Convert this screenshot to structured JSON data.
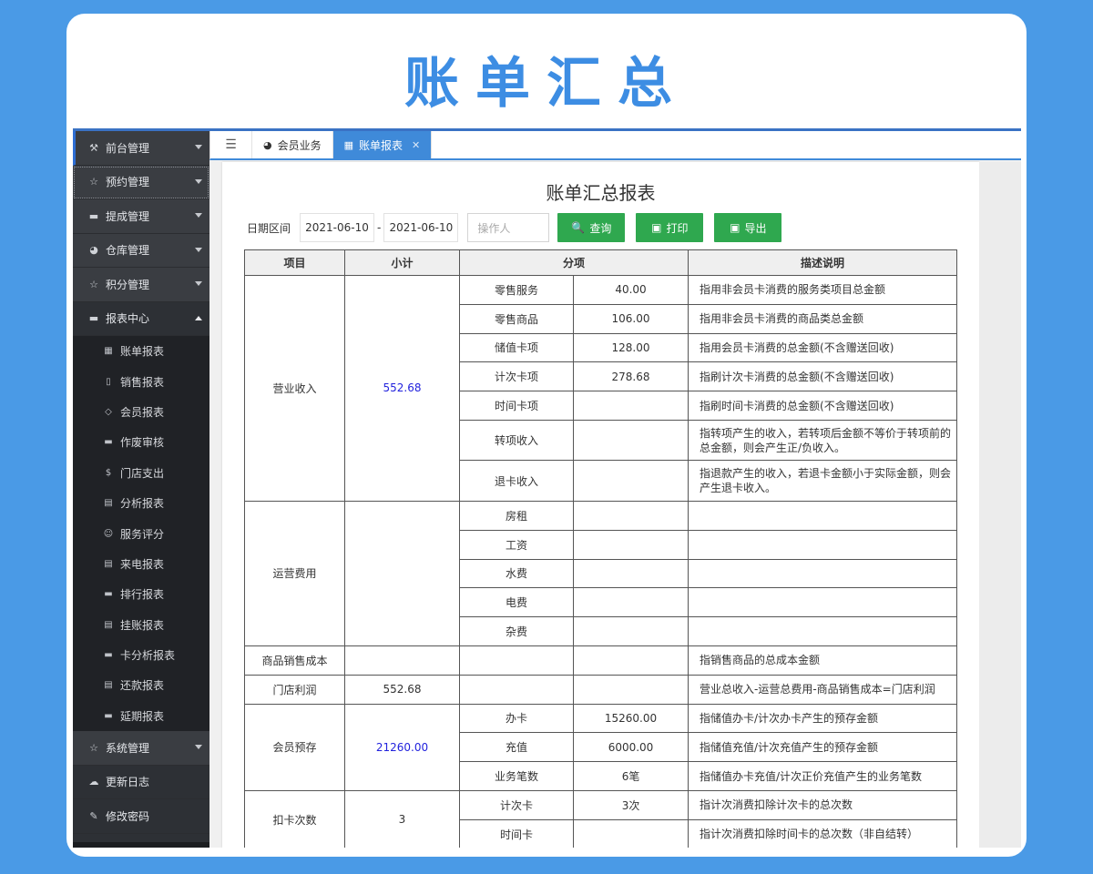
{
  "hero_title": "账单汇总",
  "sidebar": {
    "items_top": [
      {
        "label": "前台管理",
        "icon": "tools-icon",
        "glyph": "⚒"
      },
      {
        "label": "预约管理",
        "icon": "star-icon",
        "glyph": "☆"
      },
      {
        "label": "提成管理",
        "icon": "monitor-icon",
        "glyph": "▬"
      },
      {
        "label": "仓库管理",
        "icon": "dashboard-icon",
        "glyph": "◕"
      },
      {
        "label": "积分管理",
        "icon": "star-icon",
        "glyph": "☆"
      },
      {
        "label": "报表中心",
        "icon": "monitor-icon",
        "glyph": "▬"
      }
    ],
    "sub_items": [
      {
        "label": "账单报表",
        "icon": "table-icon",
        "glyph": "▦"
      },
      {
        "label": "销售报表",
        "icon": "file-icon",
        "glyph": "▯"
      },
      {
        "label": "会员报表",
        "icon": "diamond-icon",
        "glyph": "◇"
      },
      {
        "label": "作废审核",
        "icon": "monitor-icon",
        "glyph": "▬"
      },
      {
        "label": "门店支出",
        "icon": "dollar-icon",
        "glyph": "$"
      },
      {
        "label": "分析报表",
        "icon": "calendar-icon",
        "glyph": "▤"
      },
      {
        "label": "服务评分",
        "icon": "smile-icon",
        "glyph": "☺"
      },
      {
        "label": "来电报表",
        "icon": "doc-icon",
        "glyph": "▤"
      },
      {
        "label": "排行报表",
        "icon": "monitor-icon",
        "glyph": "▬"
      },
      {
        "label": "挂账报表",
        "icon": "doc-icon",
        "glyph": "▤"
      },
      {
        "label": "卡分析报表",
        "icon": "monitor-icon",
        "glyph": "▬"
      },
      {
        "label": "还款报表",
        "icon": "doc-icon",
        "glyph": "▤"
      },
      {
        "label": "延期报表",
        "icon": "monitor-icon",
        "glyph": "▬"
      }
    ],
    "items_bottom": [
      {
        "label": "系统管理",
        "icon": "star-icon",
        "glyph": "☆"
      },
      {
        "label": "更新日志",
        "icon": "cloud-upload-icon",
        "glyph": "☁"
      },
      {
        "label": "修改密码",
        "icon": "edit-icon",
        "glyph": "✎"
      }
    ]
  },
  "tabs": {
    "toggle_glyph": "☰",
    "member_glyph": "◕",
    "member": "会员业务",
    "bill_glyph": "▦",
    "bill": "账单报表",
    "close_glyph": "✕"
  },
  "report": {
    "title": "账单汇总报表",
    "filter": {
      "date_label": "日期区间",
      "date_from": "2021-06-10",
      "dash": "-",
      "date_to": "2021-06-10",
      "operator_placeholder": "操作人",
      "query": "查询",
      "query_glyph": "🔍",
      "print": "打印",
      "print_glyph": "▣",
      "export": "导出",
      "export_glyph": "▣"
    },
    "headers": {
      "item": "项目",
      "subtotal": "小计",
      "breakdown": "分项",
      "desc": "描述说明"
    },
    "revenue": {
      "label": "营业收入",
      "subtotal": "552.68",
      "rows": [
        {
          "name": "零售服务",
          "value": "40.00",
          "desc": "指用非会员卡消费的服务类项目总金额"
        },
        {
          "name": "零售商品",
          "value": "106.00",
          "desc": "指用非会员卡消费的商品类总金额"
        },
        {
          "name": "储值卡项",
          "value": "128.00",
          "desc": "指用会员卡消费的总金额(不含赠送回收)"
        },
        {
          "name": "计次卡项",
          "value": "278.68",
          "desc": "指刷计次卡消费的总金额(不含赠送回收)"
        },
        {
          "name": "时间卡项",
          "value": "",
          "desc": "指刷时间卡消费的总金额(不含赠送回收)"
        },
        {
          "name": "转项收入",
          "value": "",
          "desc": "指转项产生的收入，若转项后金额不等价于转项前的总金额，则会产生正/负收入。"
        },
        {
          "name": "退卡收入",
          "value": "",
          "desc": "指退款产生的收入，若退卡金额小于实际金额，则会产生退卡收入。"
        }
      ]
    },
    "opex": {
      "label": "运营费用",
      "subtotal": "",
      "rows": [
        {
          "name": "房租",
          "value": "",
          "desc": ""
        },
        {
          "name": "工资",
          "value": "",
          "desc": ""
        },
        {
          "name": "水费",
          "value": "",
          "desc": ""
        },
        {
          "name": "电费",
          "value": "",
          "desc": ""
        },
        {
          "name": "杂费",
          "value": "",
          "desc": ""
        }
      ]
    },
    "cogs": {
      "label": "商品销售成本",
      "subtotal": "",
      "desc": "指销售商品的总成本金额"
    },
    "profit": {
      "label": "门店利润",
      "subtotal": "552.68",
      "desc": "营业总收入-运营总费用-商品销售成本=门店利润"
    },
    "deposit": {
      "label": "会员预存",
      "subtotal": "21260.00",
      "rows": [
        {
          "name": "办卡",
          "value": "15260.00",
          "desc": "指储值办卡/计次办卡产生的预存金额"
        },
        {
          "name": "充值",
          "value": "6000.00",
          "desc": "指储值充值/计次充值产生的预存金额"
        },
        {
          "name": "业务笔数",
          "value": "6笔",
          "desc": "指储值办卡充值/计次正价充值产生的业务笔数"
        }
      ]
    },
    "deduct": {
      "label": "扣卡次数",
      "subtotal": "3",
      "rows": [
        {
          "name": "计次卡",
          "value": "3次",
          "desc": "指计次消费扣除计次卡的总次数"
        },
        {
          "name": "时间卡",
          "value": "",
          "desc": "指计次消费扣除时间卡的总次数（非自结转）"
        }
      ]
    }
  }
}
